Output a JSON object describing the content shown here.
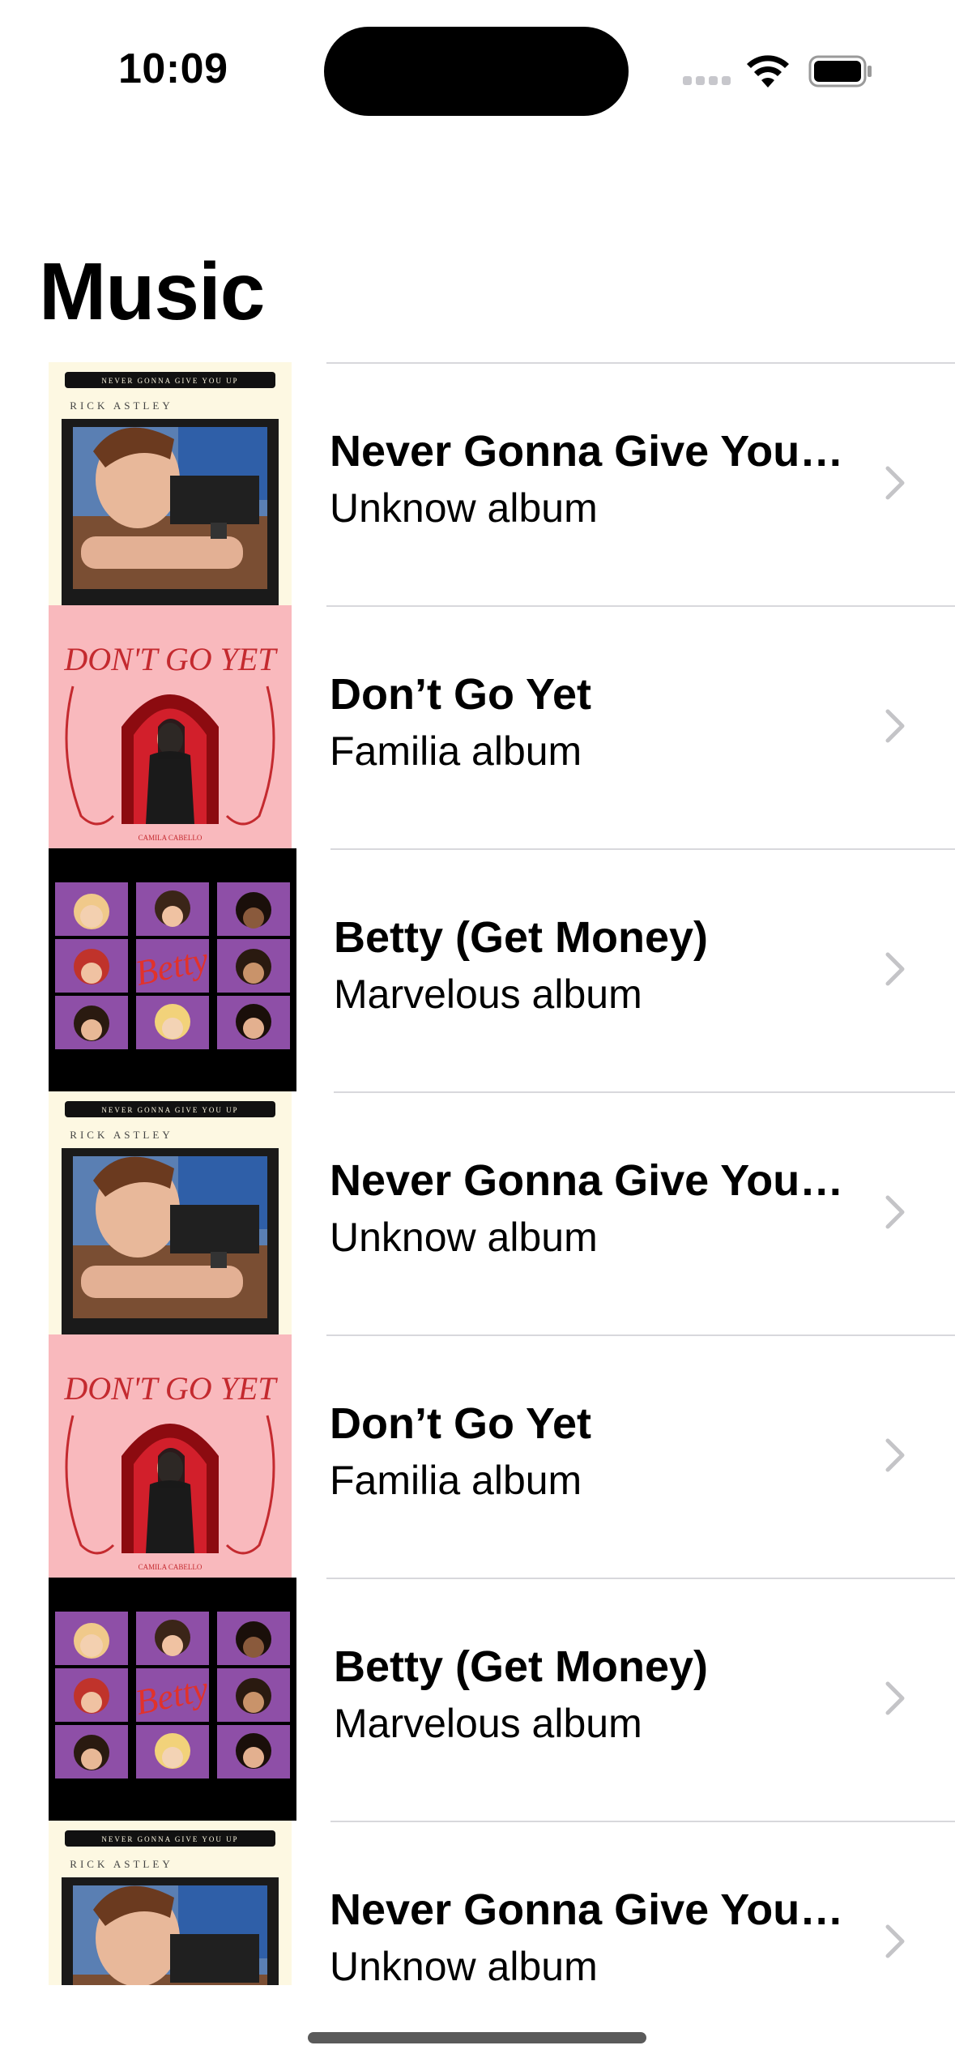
{
  "status_bar": {
    "time": "10:09"
  },
  "header": {
    "title": "Music"
  },
  "songs": [
    {
      "title": "Never Gonna Give You Up",
      "subtitle": "Unknow album",
      "artwork": "rick-astley-artwork"
    },
    {
      "title": "Don’t Go Yet",
      "subtitle": "Familia album",
      "artwork": "dont-go-yet-artwork"
    },
    {
      "title": "Betty (Get Money)",
      "subtitle": "Marvelous album",
      "artwork": "betty-artwork"
    },
    {
      "title": "Never Gonna Give You Up",
      "subtitle": "Unknow album",
      "artwork": "rick-astley-artwork"
    },
    {
      "title": "Don’t Go Yet",
      "subtitle": "Familia album",
      "artwork": "dont-go-yet-artwork"
    },
    {
      "title": "Betty (Get Money)",
      "subtitle": "Marvelous album",
      "artwork": "betty-artwork"
    },
    {
      "title": "Never Gonna Give You Up",
      "subtitle": "Unknow album",
      "artwork": "rick-astley-artwork"
    }
  ],
  "artwork_text": {
    "rick_header": "NEVER GONNA GIVE YOU UP",
    "rick_name": "RICK ASTLEY",
    "dont_go_yet_title": "DON'T GO YET",
    "dont_go_yet_artist": "CAMILA CABELLO",
    "betty_title": "Betty"
  },
  "colors": {
    "separator": "#d8d8dc",
    "chevron": "#c4c4c7",
    "rick_bg": "#fdf8e2",
    "dont_go_yet_bg": "#f9b9bd",
    "betty_bg": "#8e4fa7"
  }
}
